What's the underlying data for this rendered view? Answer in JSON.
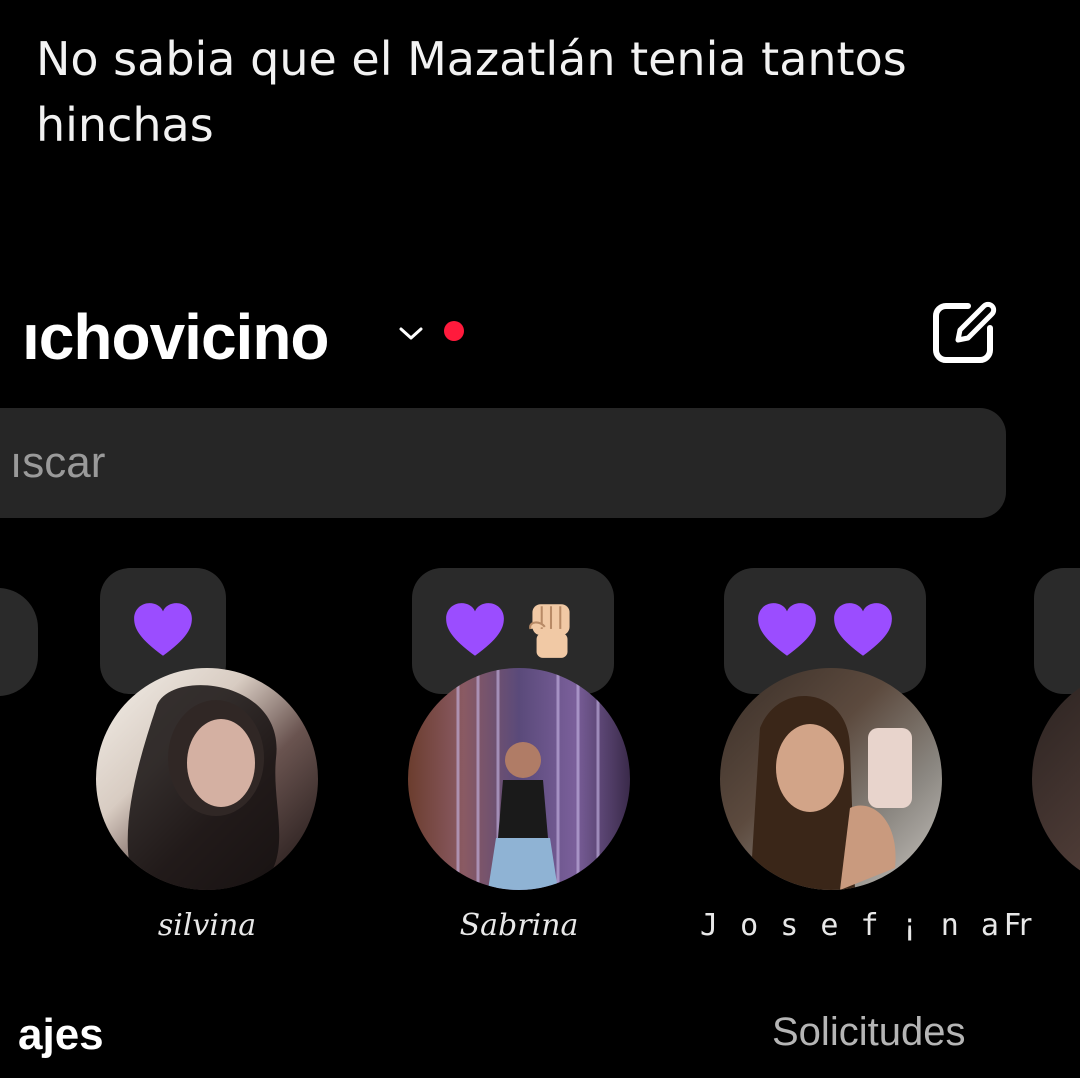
{
  "caption": "No sabia que el Mazatlán tenia tantos hinchas",
  "header": {
    "username": "ıchovicino",
    "chevron_icon": "chevron-down-icon",
    "status_color": "#ff1a3c",
    "compose_icon": "compose-icon"
  },
  "search": {
    "placeholder": "ıscar"
  },
  "stories": [
    {
      "name": "silvina",
      "note_emojis": [
        "purple-heart"
      ]
    },
    {
      "name": "Sabrina",
      "note_emojis": [
        "purple-heart",
        "raised-fist"
      ]
    },
    {
      "name": "J o s e f ¡ n a",
      "note_emojis": [
        "purple-heart",
        "purple-heart"
      ]
    },
    {
      "name": "Fr",
      "note_emojis": []
    }
  ],
  "tabs": {
    "left": "ajes",
    "right": "Solicitudes"
  },
  "colors": {
    "heart": "#9b4dff",
    "background": "#000000",
    "search_bg": "#262626"
  }
}
